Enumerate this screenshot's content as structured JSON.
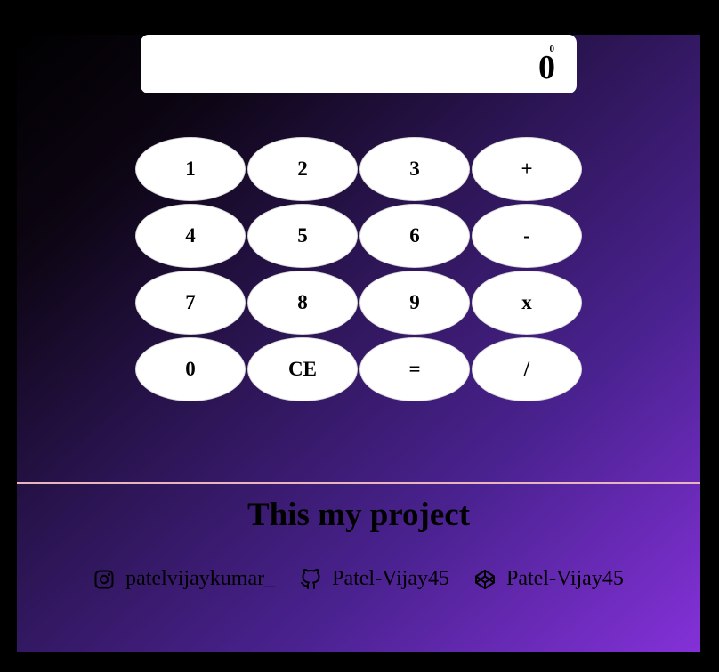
{
  "display": {
    "expression": "0",
    "result": "0"
  },
  "keys": [
    "1",
    "2",
    "3",
    "+",
    "4",
    "5",
    "6",
    "-",
    "7",
    "8",
    "9",
    "x",
    "0",
    "CE",
    "=",
    "/"
  ],
  "footer": {
    "title": "This my project",
    "links": [
      {
        "icon": "instagram-icon",
        "label": "patelvijaykumar_"
      },
      {
        "icon": "github-icon",
        "label": "Patel-Vijay45"
      },
      {
        "icon": "codepen-icon",
        "label": "Patel-Vijay45"
      }
    ]
  },
  "colors": {
    "background": "#000000",
    "gradient_end": "#8431d8",
    "divider": "#e8b4c0"
  }
}
